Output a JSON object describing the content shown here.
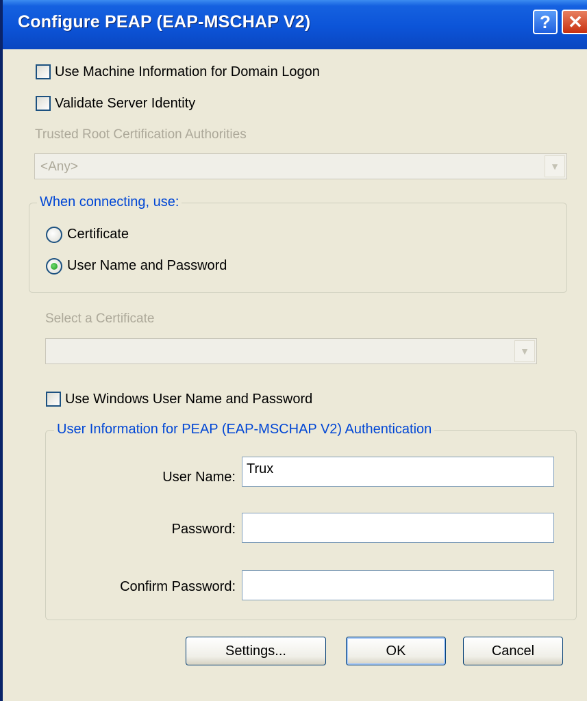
{
  "window": {
    "title": "Configure PEAP (EAP-MSCHAP V2)",
    "help_button": "?",
    "close_button": "✕"
  },
  "options": {
    "machine_info_label": "Use Machine Information for Domain Logon",
    "machine_info_checked": false,
    "validate_server_label": "Validate Server Identity",
    "validate_server_checked": false
  },
  "trusted_root": {
    "label": "Trusted Root Certification Authorities",
    "selected": "<Any>"
  },
  "when_connecting": {
    "legend": "When connecting, use:",
    "certificate_label": "Certificate",
    "username_password_label": "User Name and Password",
    "selected": "User Name and Password"
  },
  "select_certificate": {
    "label": "Select a Certificate",
    "selected": ""
  },
  "windows_credentials": {
    "label": "Use Windows User Name and Password",
    "checked": false
  },
  "user_info": {
    "legend": "User Information for PEAP (EAP-MSCHAP V2) Authentication",
    "username_label": "User Name:",
    "username_value": "Trux",
    "password_label": "Password:",
    "password_value": "",
    "confirm_label": "Confirm Password:",
    "confirm_value": ""
  },
  "buttons": {
    "settings": "Settings...",
    "ok": "OK",
    "cancel": "Cancel"
  },
  "colors": {
    "titlebar": "#0a46c0",
    "dialog_bg": "#ece9d8",
    "group_legend": "#0046d5",
    "disabled_text": "#aca899"
  }
}
